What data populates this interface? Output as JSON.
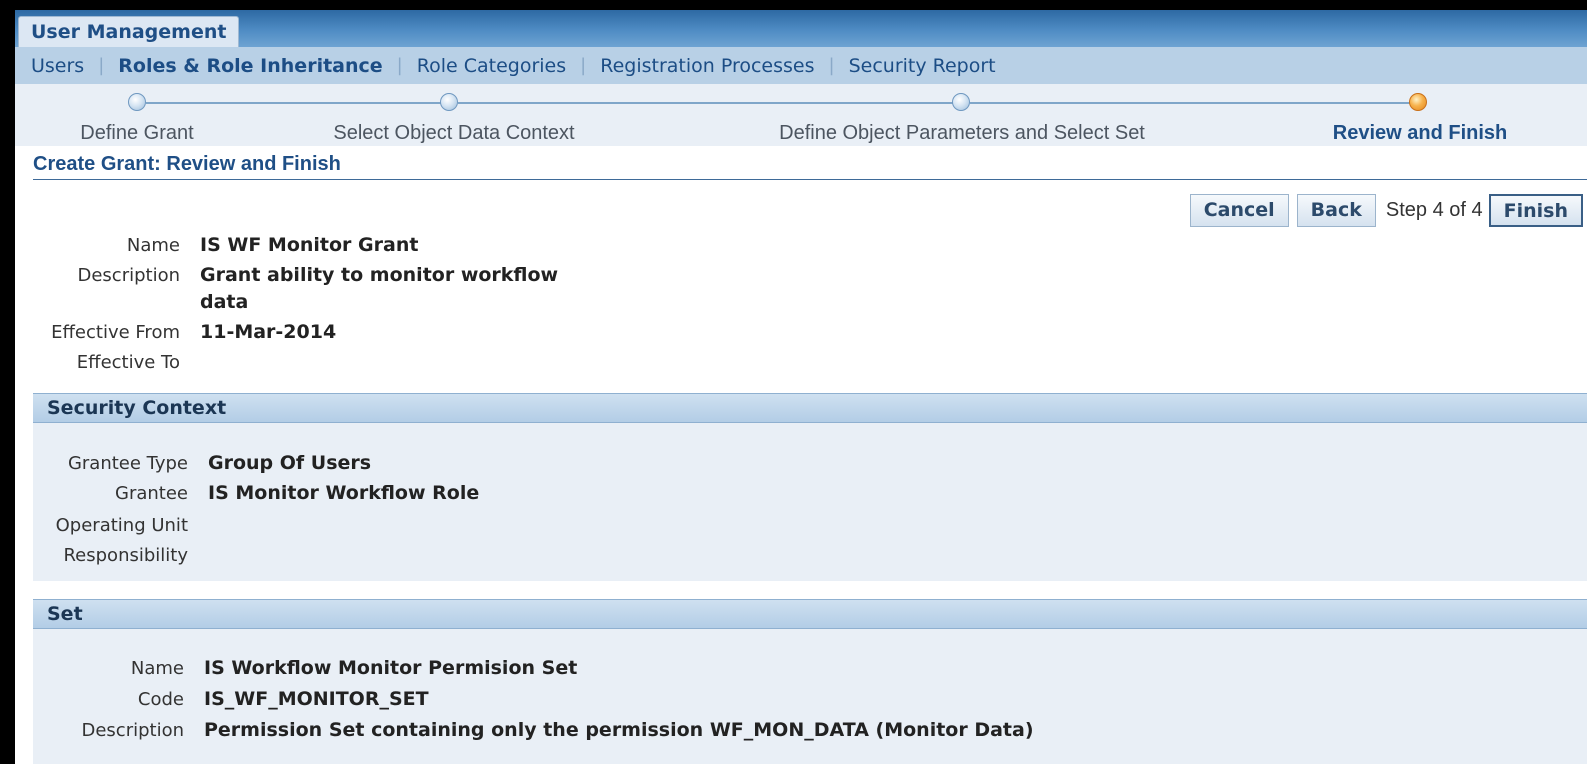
{
  "tabs": {
    "active": "User Management"
  },
  "subnav": {
    "items": [
      {
        "label": "Users",
        "current": false
      },
      {
        "label": "Roles & Role Inheritance",
        "current": true
      },
      {
        "label": "Role Categories",
        "current": false
      },
      {
        "label": "Registration Processes",
        "current": false
      },
      {
        "label": "Security Report",
        "current": false
      }
    ],
    "separator": "|"
  },
  "train": {
    "steps": [
      {
        "label": "Define Grant"
      },
      {
        "label": "Select Object Data Context"
      },
      {
        "label": "Define Object Parameters and Select Set"
      },
      {
        "label": "Review and Finish"
      }
    ],
    "current_step": 4
  },
  "page": {
    "title": "Create Grant: Review and Finish"
  },
  "buttons": {
    "cancel": "Cancel",
    "back": "Back",
    "step_text": "Step 4 of 4",
    "finish": "Finish"
  },
  "grant": {
    "name_label": "Name",
    "name": "IS WF Monitor Grant",
    "description_label": "Description",
    "description": "Grant ability to monitor workflow data",
    "effective_from_label": "Effective From",
    "effective_from": "11-Mar-2014",
    "effective_to_label": "Effective To",
    "effective_to": ""
  },
  "security_context": {
    "header": "Security Context",
    "grantee_type_label": "Grantee Type",
    "grantee_type": "Group Of Users",
    "grantee_label": "Grantee",
    "grantee": "IS Monitor Workflow Role",
    "operating_unit_label": "Operating Unit",
    "operating_unit": "",
    "responsibility_label": "Responsibility",
    "responsibility": ""
  },
  "set": {
    "header": "Set",
    "name_label": "Name",
    "name": "IS Workflow Monitor Permision Set",
    "code_label": "Code",
    "code": "IS_WF_MONITOR_SET",
    "description_label": "Description",
    "description": "Permission Set containing only the permission WF_MON_DATA (Monitor Data)"
  },
  "colors": {
    "brand_blue": "#1f4f86",
    "train_current": "#f7b24c",
    "section_bg": "#e9eff6"
  }
}
